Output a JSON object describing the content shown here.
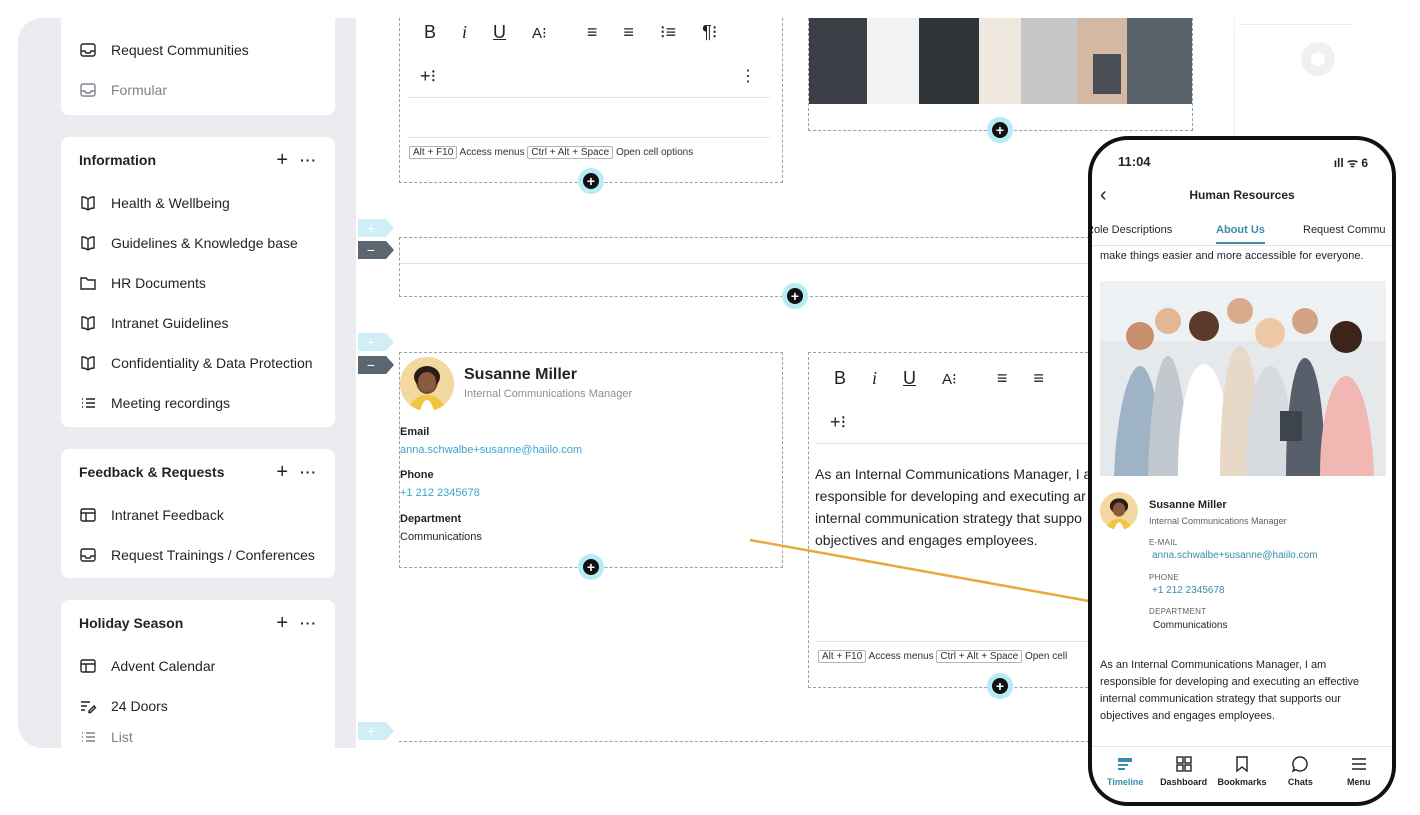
{
  "sidebar": {
    "top_card": {
      "items": [
        {
          "label": "Request Communities",
          "icon": "inbox-icon"
        },
        {
          "label": "Formular",
          "icon": "inbox-icon"
        }
      ]
    },
    "information": {
      "title": "Information",
      "add": "+",
      "more": "···",
      "items": [
        {
          "label": "Health & Wellbeing",
          "icon": "book-icon"
        },
        {
          "label": "Guidelines & Knowledge base",
          "icon": "book-icon"
        },
        {
          "label": "HR Documents",
          "icon": "folder-icon"
        },
        {
          "label": "Intranet Guidelines",
          "icon": "book-icon"
        },
        {
          "label": "Confidentiality & Data Protection",
          "icon": "book-icon"
        },
        {
          "label": "Meeting recordings",
          "icon": "list-icon"
        }
      ]
    },
    "feedback": {
      "title": "Feedback & Requests",
      "add": "+",
      "more": "···",
      "items": [
        {
          "label": "Intranet Feedback",
          "icon": "table-icon"
        },
        {
          "label": "Request Trainings / Conferences",
          "icon": "inbox-icon"
        }
      ]
    },
    "holiday": {
      "title": "Holiday Season",
      "add": "+",
      "more": "···",
      "items": [
        {
          "label": "Advent Calendar",
          "icon": "table-icon"
        },
        {
          "label": "24 Doors",
          "icon": "edit-list-icon"
        },
        {
          "label": "List",
          "icon": "list-icon"
        }
      ]
    }
  },
  "editor": {
    "toolbar": {
      "bold": "B",
      "italic": "i",
      "underline": "U",
      "font": "A⁝",
      "align_left": "≡",
      "align_center": "≡",
      "numbered_list": "⁝≡",
      "paragraph": "¶⁝",
      "insert": "+⁝",
      "more": "⋮"
    },
    "hint": {
      "key1": "Alt + F10",
      "text1": "Access menus",
      "key2": "Ctrl + Alt + Space",
      "text2": "Open cell options",
      "text2_short": "Open cell"
    },
    "profile": {
      "name": "Susanne Miller",
      "role": "Internal Communications Manager",
      "email_label": "Email",
      "email": "anna.schwalbe+susanne@haiilo.com",
      "phone_label": "Phone",
      "phone": "+1 212 2345678",
      "department_label": "Department",
      "department": "Communications"
    },
    "body_text": {
      "line1": "As an Internal Communications Manager, I a",
      "line2": "responsible for developing and executing ar",
      "line3": "internal communication strategy that suppo",
      "line4": "objectives and engages employees."
    }
  },
  "phone": {
    "time": "11:04",
    "status_icons": "ıll ᯤ 6",
    "title": "Human Resources",
    "back": "‹",
    "tabs": [
      "Role Descriptions",
      "About Us",
      "Request Commu"
    ],
    "active_tab": "About Us",
    "intro": "make things easier and more accessible for everyone.",
    "profile": {
      "name": "Susanne Miller",
      "role": "Internal Communications Manager",
      "email_label": "E-MAIL",
      "email": "anna.schwalbe+susanne@haiilo.com",
      "phone_label": "PHONE",
      "phone": "+1 212 2345678",
      "department_label": "DEPARTMENT",
      "department": "Communications"
    },
    "body": {
      "line1": "As an Internal Communications Manager, I am",
      "line2": "responsible for developing and executing an effective",
      "line3": "internal communication strategy that supports our",
      "line4": "objectives and engages employees."
    },
    "nav": [
      {
        "label": "Timeline",
        "icon": "timeline-icon"
      },
      {
        "label": "Dashboard",
        "icon": "dashboard-icon"
      },
      {
        "label": "Bookmarks",
        "icon": "bookmark-icon"
      },
      {
        "label": "Chats",
        "icon": "chat-icon"
      },
      {
        "label": "Menu",
        "icon": "menu-icon"
      }
    ]
  },
  "colors": {
    "accent": "#3aa6c9",
    "arrow": "#e8a93a",
    "sidebar_bg": "#ebecef"
  }
}
